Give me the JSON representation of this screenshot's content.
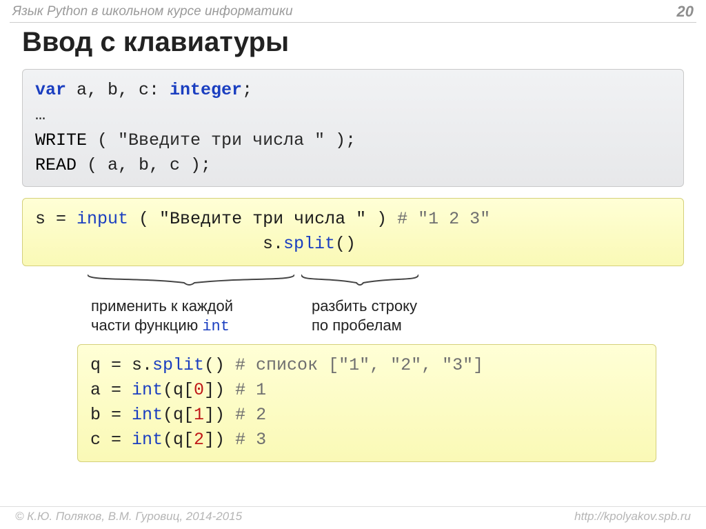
{
  "header": {
    "course_title": "Язык Python в школьном курсе информатики",
    "page_number": "20"
  },
  "title": "Ввод с клавиатуры",
  "pascal": {
    "line1_pre": "var",
    "line1_mid": " a, b, c: ",
    "line1_type": "integer",
    "line1_end": ";",
    "line2": "…",
    "line3_fn": "WRITE",
    "line3_open": " ( ",
    "line3_str": "\"Введите три числа \"",
    "line3_end": " );",
    "line4_fn": "READ",
    "line4_args": " ( a, b, c );"
  },
  "python1": {
    "line1_lhs": "s = ",
    "line1_fn": "input",
    "line1_open": " ( ",
    "line1_str": "\"Введите три числа \"",
    "line1_close": " )",
    "line1_comment": " # \"1 2 3\"",
    "line2_obj": "s.",
    "line2_fn": "split",
    "line2_call": "()"
  },
  "annotations": {
    "left_line1": "применить к каждой",
    "left_line2_pre": "части функцию ",
    "left_line2_kw": "int",
    "right_line1": "разбить строку",
    "right_line2": "по пробелам"
  },
  "python2": {
    "l1_lhs": "q = s.",
    "l1_fn": "split",
    "l1_call": "()  ",
    "l1_comment": "# список [\"1\", \"2\", \"3\"]",
    "l2_lhs": "a = ",
    "l2_fn": "int",
    "l2_open": "(q[",
    "l2_idx": "0",
    "l2_close": "])  ",
    "l2_comment": "# 1",
    "l3_lhs": "b = ",
    "l3_fn": "int",
    "l3_open": "(q[",
    "l3_idx": "1",
    "l3_close": "])  ",
    "l3_comment": "# 2",
    "l4_lhs": "c = ",
    "l4_fn": "int",
    "l4_open": "(q[",
    "l4_idx": "2",
    "l4_close": "])  ",
    "l4_comment": "# 3"
  },
  "footer": {
    "left": "© К.Ю. Поляков, В.М. Гуровиц, 2014-2015",
    "right": "http://kpolyakov.spb.ru"
  }
}
